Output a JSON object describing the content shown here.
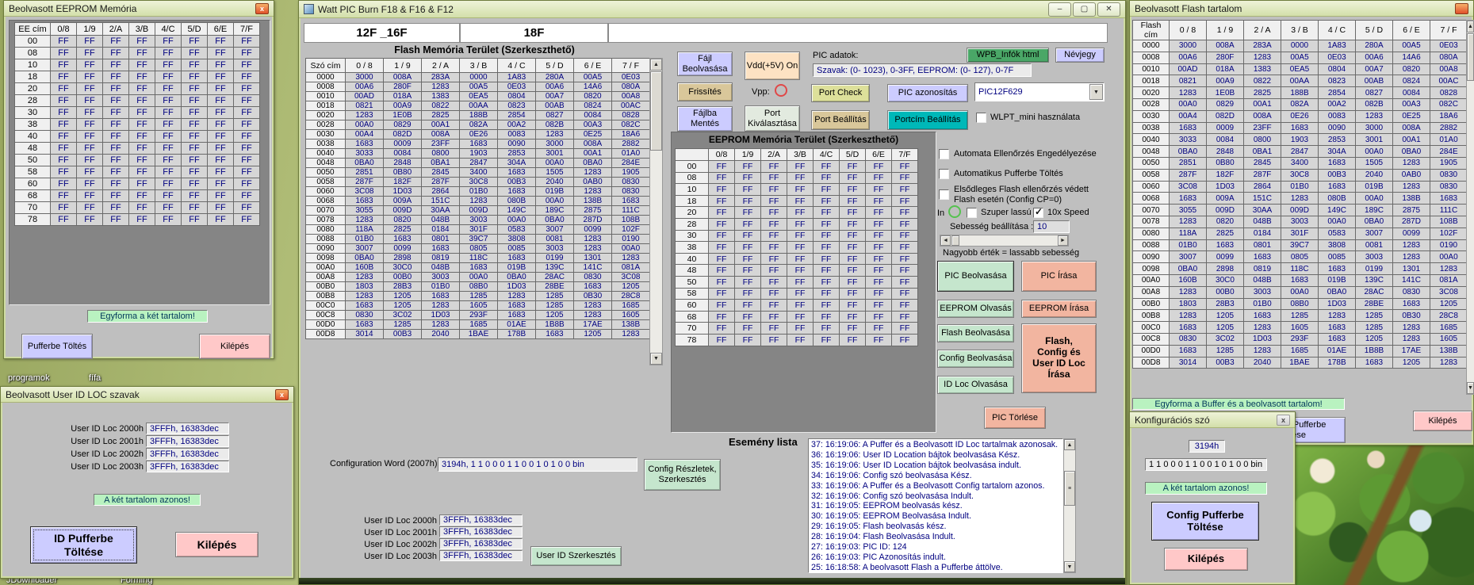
{
  "colors": {
    "navy": "#000080",
    "winbg": "#bfbfbf",
    "darkpanel": "#858585",
    "mint": "#c5e6cd",
    "salmon": "#f2b5a0",
    "pink": "#ffc8c8",
    "lavender": "#ccccff",
    "tan": "#d9c79a",
    "khaki": "#dde09a",
    "peach": "#fde2c3",
    "teal": "#00b8b8",
    "wpbgreen": "#4aa767",
    "portsel": "#e2eadf",
    "statusgreen": "#b9f2c0",
    "cellbg": "#d6d6d6",
    "headbg": "#f0f0f0",
    "titlebar1": "#eef3d8",
    "titlebar2": "#d3dfaa"
  },
  "desktop": {
    "icons": [
      "programok",
      "fífa",
      "JDownloader",
      "Forming"
    ]
  },
  "eeprom_window": {
    "title": "Beolvasott EEPROM Memória",
    "close": "x",
    "table": {
      "addr_header": "EE cím",
      "cols": [
        "0/8",
        "1/9",
        "2/A",
        "3/B",
        "4/C",
        "5/D",
        "6/E",
        "7/F"
      ],
      "addresses": [
        "00",
        "08",
        "10",
        "18",
        "20",
        "28",
        "30",
        "38",
        "40",
        "48",
        "50",
        "58",
        "60",
        "68",
        "70",
        "78"
      ],
      "fill": "FF"
    },
    "status": "Egyforma a két tartalom!",
    "load_button": "Pufferbe Töltés",
    "exit_button": "Kilépés"
  },
  "userid_window": {
    "title": "Beolvasott User ID LOC szavak",
    "close": "x",
    "rows": [
      {
        "label": "User ID Loc 2000h",
        "value": "3FFFh, 16383dec"
      },
      {
        "label": "User ID Loc 2001h",
        "value": "3FFFh, 16383dec"
      },
      {
        "label": "User ID Loc 2002h",
        "value": "3FFFh, 16383dec"
      },
      {
        "label": "User ID Loc 2003h",
        "value": "3FFFh, 16383dec"
      }
    ],
    "status": "A két tartalom azonos!",
    "load_button": "ID Pufferbe\nTöltése",
    "exit_button": "Kilépés"
  },
  "main_window": {
    "title": "Watt PIC Burn F18 & F16 & F12",
    "controls": {
      "minimize": "–",
      "maximize": "▢",
      "close": "✕"
    },
    "tabs": [
      "12F _16F",
      "18F"
    ],
    "flash_title": "Flash Memória Terület (Szerkeszthető)",
    "flash_table": {
      "addr_header": "Szó cím",
      "cols": [
        "0 / 8",
        "1 / 9",
        "2 / A",
        "3 / B",
        "4 / C",
        "5 / D",
        "6 / E",
        "7 / F"
      ],
      "rows": [
        [
          "0000",
          "3000",
          "008A",
          "283A",
          "0000",
          "1A83",
          "280A",
          "00A5",
          "0E03"
        ],
        [
          "0008",
          "00A6",
          "280F",
          "1283",
          "00A5",
          "0E03",
          "00A6",
          "14A6",
          "080A"
        ],
        [
          "0010",
          "00AD",
          "018A",
          "1383",
          "0EA5",
          "0804",
          "00A7",
          "0820",
          "00A8"
        ],
        [
          "0018",
          "0821",
          "00A9",
          "0822",
          "00AA",
          "0823",
          "00AB",
          "0824",
          "00AC"
        ],
        [
          "0020",
          "1283",
          "1E0B",
          "2825",
          "188B",
          "2854",
          "0827",
          "0084",
          "0828"
        ],
        [
          "0028",
          "00A0",
          "0829",
          "00A1",
          "082A",
          "00A2",
          "082B",
          "00A3",
          "082C"
        ],
        [
          "0030",
          "00A4",
          "082D",
          "008A",
          "0E26",
          "0083",
          "1283",
          "0E25",
          "18A6"
        ],
        [
          "0038",
          "1683",
          "0009",
          "23FF",
          "1683",
          "0090",
          "3000",
          "008A",
          "2882"
        ],
        [
          "0040",
          "3033",
          "0084",
          "0800",
          "1903",
          "2853",
          "3001",
          "00A1",
          "01A0"
        ],
        [
          "0048",
          "0BA0",
          "2848",
          "0BA1",
          "2847",
          "304A",
          "00A0",
          "0BA0",
          "284E"
        ],
        [
          "0050",
          "2851",
          "0B80",
          "2845",
          "3400",
          "1683",
          "1505",
          "1283",
          "1905"
        ],
        [
          "0058",
          "287F",
          "182F",
          "287F",
          "30C8",
          "00B3",
          "2040",
          "0AB0",
          "0830"
        ],
        [
          "0060",
          "3C08",
          "1D03",
          "2864",
          "01B0",
          "1683",
          "019B",
          "1283",
          "0830"
        ],
        [
          "0068",
          "1683",
          "009A",
          "151C",
          "1283",
          "080B",
          "00A0",
          "138B",
          "1683"
        ],
        [
          "0070",
          "3055",
          "009D",
          "30AA",
          "009D",
          "149C",
          "189C",
          "2875",
          "111C"
        ],
        [
          "0078",
          "1283",
          "0820",
          "048B",
          "3003",
          "00A0",
          "0BA0",
          "287D",
          "108B"
        ],
        [
          "0080",
          "118A",
          "2825",
          "0184",
          "301F",
          "0583",
          "3007",
          "0099",
          "102F"
        ],
        [
          "0088",
          "01B0",
          "1683",
          "0801",
          "39C7",
          "3808",
          "0081",
          "1283",
          "0190"
        ],
        [
          "0090",
          "3007",
          "0099",
          "1683",
          "0805",
          "0085",
          "3003",
          "1283",
          "00A0"
        ],
        [
          "0098",
          "0BA0",
          "2898",
          "0819",
          "118C",
          "1683",
          "0199",
          "1301",
          "1283"
        ],
        [
          "00A0",
          "160B",
          "30C0",
          "048B",
          "1683",
          "019B",
          "139C",
          "141C",
          "081A"
        ],
        [
          "00A8",
          "1283",
          "00B0",
          "3003",
          "00A0",
          "0BA0",
          "28AC",
          "0830",
          "3C08"
        ],
        [
          "00B0",
          "1803",
          "28B3",
          "01B0",
          "08B0",
          "1D03",
          "28BE",
          "1683",
          "1205"
        ],
        [
          "00B8",
          "1283",
          "1205",
          "1683",
          "1285",
          "1283",
          "1285",
          "0B30",
          "28C8"
        ],
        [
          "00C0",
          "1683",
          "1205",
          "1283",
          "1605",
          "1683",
          "1285",
          "1283",
          "1685"
        ],
        [
          "00C8",
          "0830",
          "3C02",
          "1D03",
          "293F",
          "1683",
          "1205",
          "1283",
          "1605"
        ],
        [
          "00D0",
          "1683",
          "1285",
          "1283",
          "1685",
          "01AE",
          "1B8B",
          "17AE",
          "138B"
        ],
        [
          "00D8",
          "3014",
          "00B3",
          "2040",
          "1BAE",
          "178B",
          "1683",
          "1205",
          "1283"
        ]
      ]
    },
    "buttons": {
      "open_file": "Fájl\nBeolvasása",
      "refresh": "Frissítés",
      "save_file": "Fájlba\nMentés",
      "vdd": "Vdd(+5V) On",
      "vpp_label": "Vpp:",
      "port_select": "Port\nKiválasztása",
      "port_check": "Port Check",
      "pic_identify": "PIC azonosítás",
      "port_setup": "Port Beállítás",
      "portaddr_setup": "Portcím Beállítás",
      "wpb_info": "WPB_Infók html",
      "about": "Névjegy"
    },
    "pic_data_label": "PIC adatok:",
    "pic_data_value": "Szavak: (0- 1023),  0-3FF,   EEPROM: (0- 127),  0-7F",
    "pic_type": "PIC12F629",
    "wlpt_checkbox": {
      "label": "WLPT_mini használata",
      "checked": false
    },
    "eeprom_title": "EEPROM Memória Terület (Szerkeszthető)",
    "eeprom_table": {
      "addr_header": "",
      "cols": [
        "0/8",
        "1/9",
        "2/A",
        "3/B",
        "4/C",
        "5/D",
        "6/E",
        "7/F"
      ],
      "addresses": [
        "00",
        "08",
        "10",
        "18",
        "20",
        "28",
        "30",
        "38",
        "40",
        "48",
        "50",
        "58",
        "60",
        "68",
        "70",
        "78"
      ],
      "fill": "FF"
    },
    "options": [
      {
        "label": "Automata Ellenőrzés Engedélyezése",
        "checked": false
      },
      {
        "label": "Automatikus Pufferbe Töltés",
        "checked": false
      },
      {
        "label": "Elsődleges Flash ellenőrzés védett\nFlash esetén (Config CP=0)",
        "checked": false
      }
    ],
    "in_label": "In",
    "slow_checkbox": {
      "label": "Szuper lassú",
      "checked": false
    },
    "speed_checkbox": {
      "label": "10x Speed",
      "checked": true
    },
    "speed_label": "Sebesség beállítása :",
    "speed_value": "10",
    "speed_note": "Nagyobb érték = lassabb sebesség",
    "action_buttons": {
      "read_pic": "PIC Beolvasása",
      "write_pic": "PIC  Írása",
      "read_eeprom": "EEPROM Olvasás",
      "write_eeprom": "EEPROM Írása",
      "read_flash": "Flash Beolvasása",
      "write_flash": "Flash,\nConfig és\nUser ID Loc\nÍrása",
      "read_config": "Config Beolvasása",
      "read_idloc": "ID Loc Olvasása",
      "erase_pic": "PIC  Törlése"
    },
    "config_word_label": "Configuration Word (2007h):",
    "config_word_value": "3194h, 1 1 0 0 0 1 1 0 0 1 0 1 0 0 bin",
    "config_details_button": "Config Részletek,\nSzerkesztés",
    "userid_rows": [
      {
        "label": "User ID Loc 2000h",
        "value": "3FFFh, 16383dec"
      },
      {
        "label": "User ID Loc 2001h",
        "value": "3FFFh, 16383dec"
      },
      {
        "label": "User ID Loc 2002h",
        "value": "3FFFh, 16383dec"
      },
      {
        "label": "User ID Loc 2003h",
        "value": "3FFFh, 16383dec"
      }
    ],
    "userid_edit_button": "User ID Szerkesztés",
    "event_list_label": "Esemény lista",
    "event_list": [
      "37:  16:19:06:  A Puffer és a Beolvasott ID Loc tartalmak azonosak.",
      "36:  16:19:06:  User ID Location bájtok beolvasása Kész.",
      "35:  16:19:06:  User ID Location bájtok beolvasása indult.",
      "34:  16:19:06:  Config szó beolvasása Kész.",
      "33:  16:19:06:  A Puffer és a Beolvasott Config tartalom azonos.",
      "32:  16:19:06:  Config szó beolvasása Indult.",
      "31:  16:19:05:  EEPROM beolvasás kész.",
      "30:  16:19:05:  EEPROM Beolvasása Indult.",
      "29:  16:19:05:  Flash beolvasás kész.",
      "28:  16:19:04:  Flash Beolvasása Indult.",
      "27:  16:19:03:  PIC ID: 124",
      "26:  16:19:03:  PIC Azonosítás indult.",
      "25:  16:18:58:  A beolvasott Flash a Pufferbe áttölve."
    ]
  },
  "flash_window": {
    "title": "Beolvasott Flash tartalom",
    "table": {
      "addr_header": "Flash cím",
      "cols": [
        "0 / 8",
        "1 / 9",
        "2 / A",
        "3 / B",
        "4 / C",
        "5 / D",
        "6 / E",
        "7 / F"
      ]
    },
    "status": "Egyforma a Buffer és a beolvasott tartalom!",
    "load_button": "Tartalom Pufferbe\nTöltése",
    "exit_button": "Kilépés"
  },
  "config_window": {
    "title": "Konfigurációs szó",
    "close": "x",
    "hex_value": "3194h",
    "bin_value": "1 1 0 0 0 1 1 0 0 1 0 1 0 0 bin",
    "status": "A két tartalom azonos!",
    "load_button": "Config Pufferbe\nTöltése",
    "exit_button": "Kilépés"
  }
}
